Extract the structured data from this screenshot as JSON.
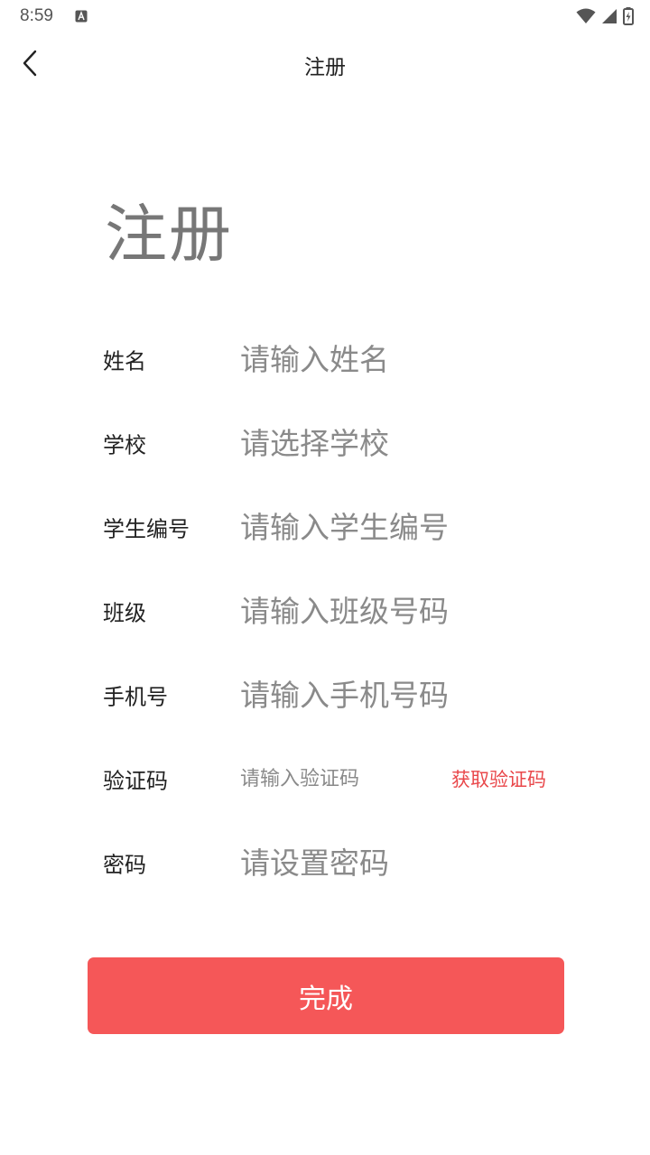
{
  "status_bar": {
    "time": "8:59",
    "icons": [
      "notification-a-icon",
      "wifi-icon",
      "signal-icon",
      "battery-charging-icon"
    ]
  },
  "nav": {
    "title": "注册",
    "back_icon": "chevron-left-icon"
  },
  "page": {
    "heading": "注册"
  },
  "form": {
    "name": {
      "label": "姓名",
      "placeholder": "请输入姓名"
    },
    "school": {
      "label": "学校",
      "placeholder": "请选择学校"
    },
    "student_id": {
      "label": "学生编号",
      "placeholder": "请输入学生编号"
    },
    "class": {
      "label": "班级",
      "placeholder": "请输入班级号码"
    },
    "phone": {
      "label": "手机号",
      "placeholder": "请输入手机号码"
    },
    "code": {
      "label": "验证码",
      "placeholder": "请输入验证码",
      "button_label": "获取验证码"
    },
    "password": {
      "label": "密码",
      "placeholder": "请设置密码"
    }
  },
  "submit_label": "完成",
  "colors": {
    "accent": "#f55758",
    "code_link": "#e9474a",
    "placeholder": "#8a8a8a",
    "heading": "#777777"
  }
}
